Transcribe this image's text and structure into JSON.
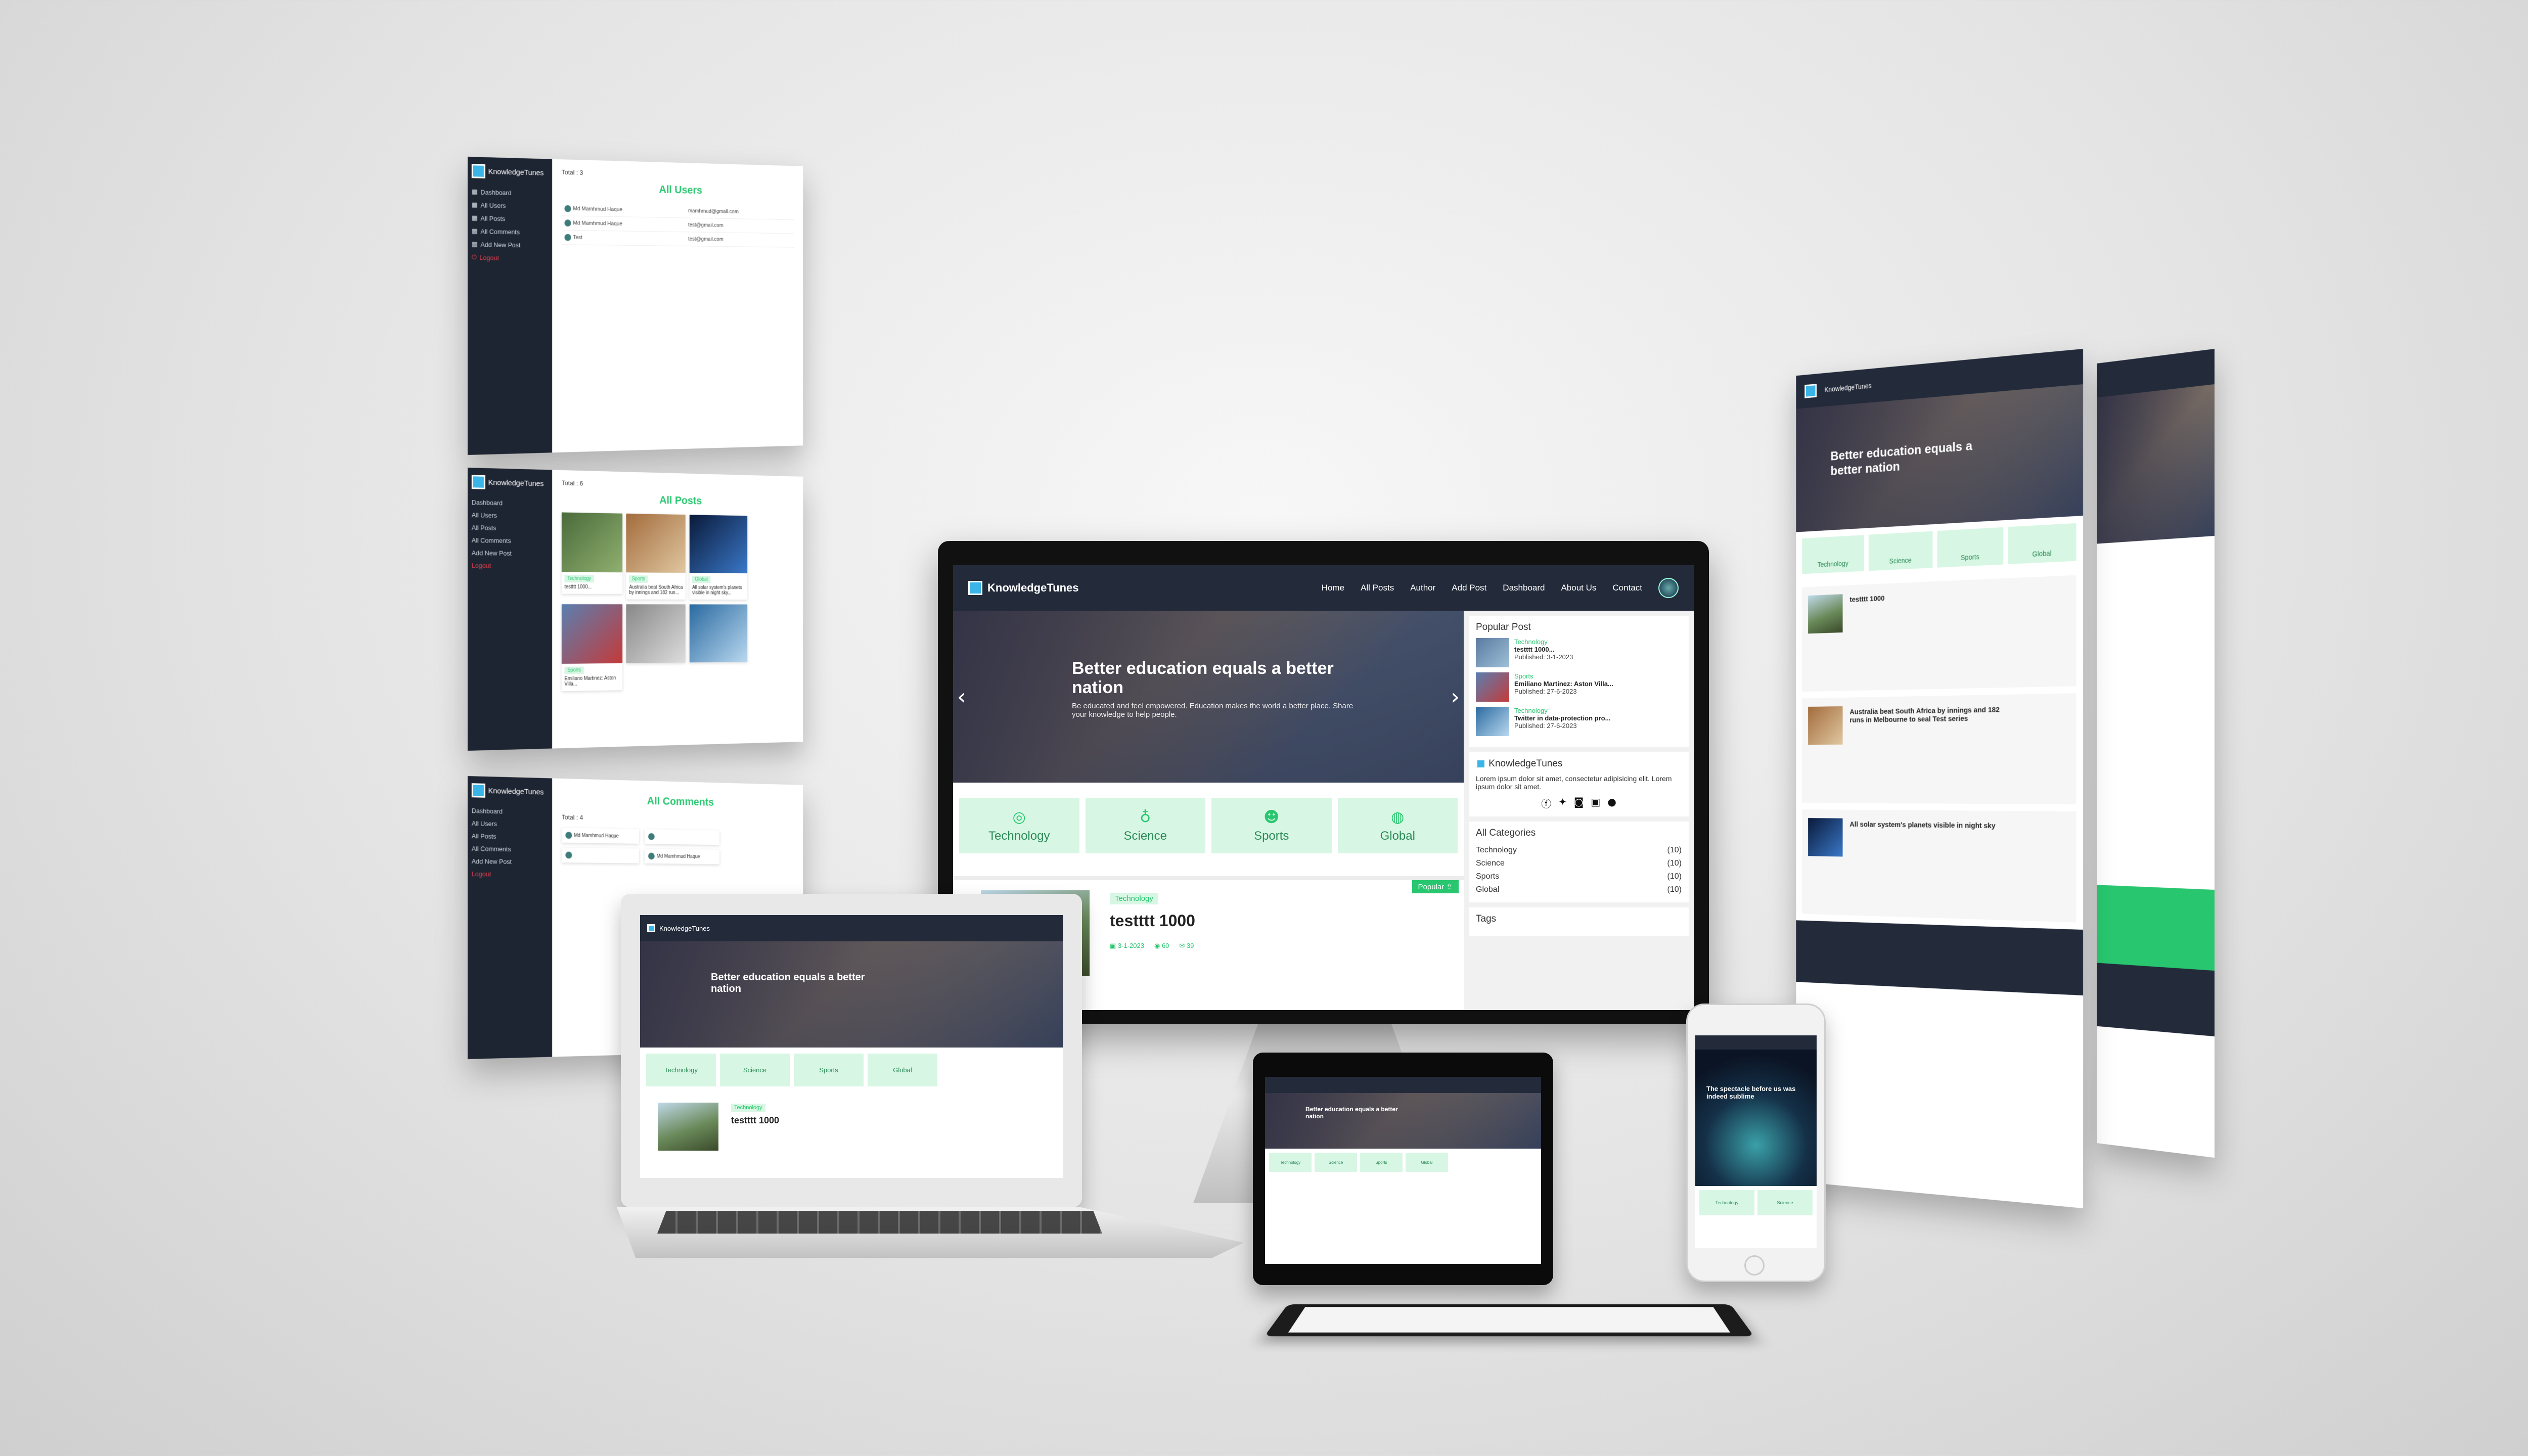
{
  "brand": "KnowledgeTunes",
  "nav": [
    "Home",
    "All Posts",
    "Author",
    "Add Post",
    "Dashboard",
    "About Us",
    "Contact"
  ],
  "hero": {
    "title": "Better education equals a better nation",
    "subtitle": "Be educated and feel empowered. Education makes the world a better place. Share your knowledge to help people."
  },
  "categories": [
    "Technology",
    "Science",
    "Sports",
    "Global"
  ],
  "post": {
    "category": "Technology",
    "title": "testttt 1000",
    "date": "3-1-2023",
    "views": "60",
    "comments": "39",
    "popular": "Popular"
  },
  "sidebar": {
    "popular_heading": "Popular Post",
    "popular": [
      {
        "category": "Technology",
        "title": "testttt 1000...",
        "date": "Published: 3-1-2023"
      },
      {
        "category": "Sports",
        "title": "Emiliano Martinez: Aston Villa...",
        "date": "Published: 27-6-2023"
      },
      {
        "category": "Technology",
        "title": "Twitter in data-protection pro...",
        "date": "Published: 27-6-2023"
      }
    ],
    "about_brand": "KnowledgeTunes",
    "about_text": "Lorem ipsum dolor sit amet, consectetur adipisicing elit. Lorem ipsum dolor sit amet.",
    "categories_heading": "All Categories",
    "category_counts": [
      {
        "name": "Technology",
        "count": "(10)"
      },
      {
        "name": "Science",
        "count": "(10)"
      },
      {
        "name": "Sports",
        "count": "(10)"
      },
      {
        "name": "Global",
        "count": "(10)"
      }
    ],
    "tags_heading": "Tags"
  },
  "admin": {
    "menu": [
      "Dashboard",
      "All Users",
      "All Posts",
      "All Comments",
      "Add New Post",
      "Logout"
    ],
    "users": {
      "heading": "All Users",
      "total": "Total : 3",
      "rows": [
        {
          "name": "Md Mamhmud Haque",
          "email": "mamhmud@gmail.com"
        },
        {
          "name": "Md Mamhmud Haque",
          "email": "test@gmail.com"
        },
        {
          "name": "Test",
          "email": "test@gmail.com"
        }
      ]
    },
    "posts": {
      "heading": "All Posts",
      "total": "Total : 6",
      "cards": [
        {
          "category": "Technology",
          "title": "testttt 1000..."
        },
        {
          "category": "Sports",
          "title": "Australia beat South Africa by innings and 182 run..."
        },
        {
          "category": "Global",
          "title": "All solar system's planets visible in night sky..."
        },
        {
          "category": "Sports",
          "title": "Emiliano Martinez: Aston Villa..."
        }
      ]
    },
    "comments": {
      "heading": "All Comments",
      "total": "Total : 4"
    }
  },
  "right": {
    "post2": "Australia beat South Africa by innings and 182 runs in Melbourne to seal Test series",
    "post3": "All solar system's planets visible in night sky",
    "author": "Md Mamhmud Haque",
    "add_post": "Add New Post"
  },
  "phone": {
    "hero": "The spectacle before us was indeed sublime"
  }
}
